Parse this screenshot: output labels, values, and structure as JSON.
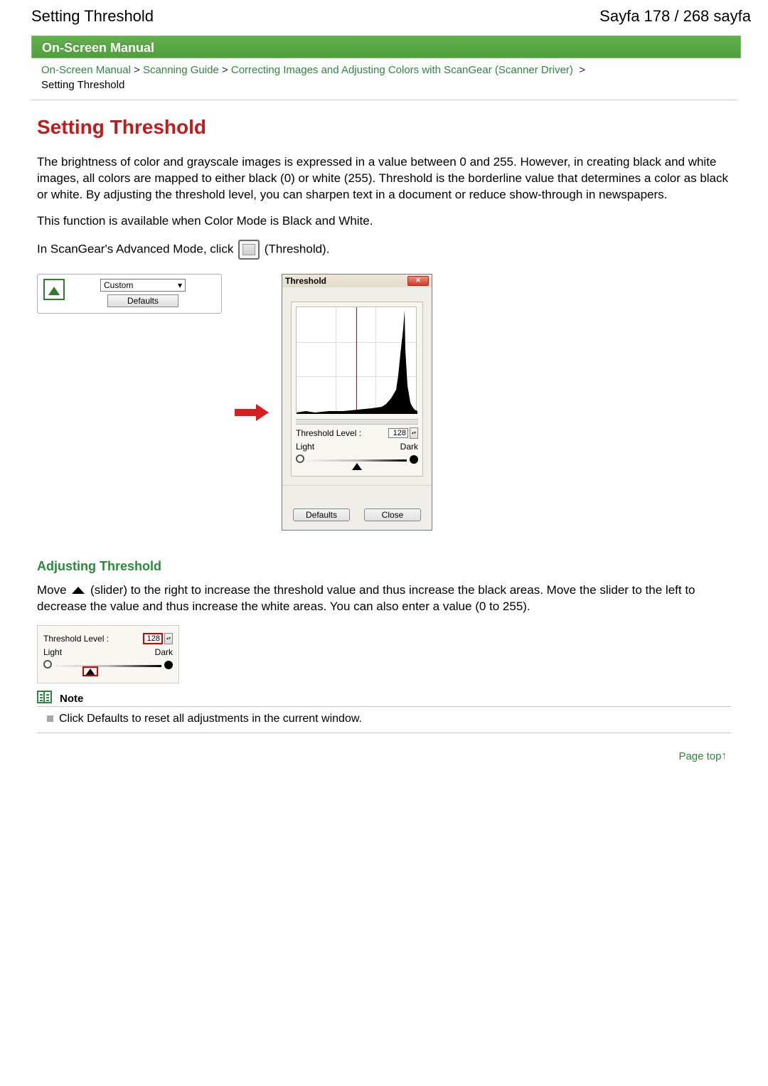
{
  "header": {
    "title_left": "Setting Threshold",
    "title_right": "Sayfa 178 / 268 sayfa"
  },
  "green_bar": "On-Screen Manual",
  "breadcrumb": {
    "items": [
      "On-Screen Manual",
      "Scanning Guide",
      "Correcting Images and Adjusting Colors with ScanGear (Scanner Driver)"
    ],
    "sep": ">",
    "current": "Setting Threshold"
  },
  "article": {
    "title": "Setting Threshold",
    "p1": "The brightness of color and grayscale images is expressed in a value between 0 and 255. However, in creating black and white images, all colors are mapped to either black (0) or white (255). Threshold is the borderline value that determines a color as black or white. By adjusting the threshold level, you can sharpen text in a document or reduce show-through in newspapers.",
    "p2": "This function is available when Color Mode is Black and White.",
    "p3a": "In ScanGear's Advanced Mode, click ",
    "p3b": " (Threshold)."
  },
  "custom_box": {
    "select": "Custom",
    "defaults_btn": "Defaults"
  },
  "dialog": {
    "title": "Threshold",
    "level_label": "Threshold Level :",
    "level_value": "128",
    "light": "Light",
    "dark": "Dark",
    "defaults_btn": "Defaults",
    "close_btn": "Close"
  },
  "section2": {
    "heading": "Adjusting Threshold",
    "p_a": "Move ",
    "p_b": " (slider) to the right to increase the threshold value and thus increase the black areas. Move the slider to the left to decrease the value and thus increase the white areas. You can also enter a value (0 to 255)."
  },
  "callout": {
    "level_label": "Threshold Level :",
    "level_value": "128",
    "light": "Light",
    "dark": "Dark"
  },
  "note": {
    "label": "Note",
    "text": "Click Defaults to reset all adjustments in the current window."
  },
  "page_top": "Page top",
  "chart_data": {
    "type": "area",
    "title": "Threshold histogram",
    "xlabel": "",
    "ylabel": "",
    "xlim": [
      0,
      255
    ],
    "ylim": [
      0,
      100
    ],
    "threshold_line_x": 128,
    "x": [
      0,
      20,
      40,
      70,
      100,
      130,
      160,
      180,
      190,
      200,
      210,
      215,
      220,
      225,
      228,
      230,
      235,
      240,
      245,
      250,
      255
    ],
    "y": [
      2,
      3,
      2,
      3,
      3,
      4,
      5,
      6,
      8,
      12,
      20,
      35,
      55,
      80,
      98,
      60,
      25,
      10,
      6,
      4,
      3
    ]
  }
}
